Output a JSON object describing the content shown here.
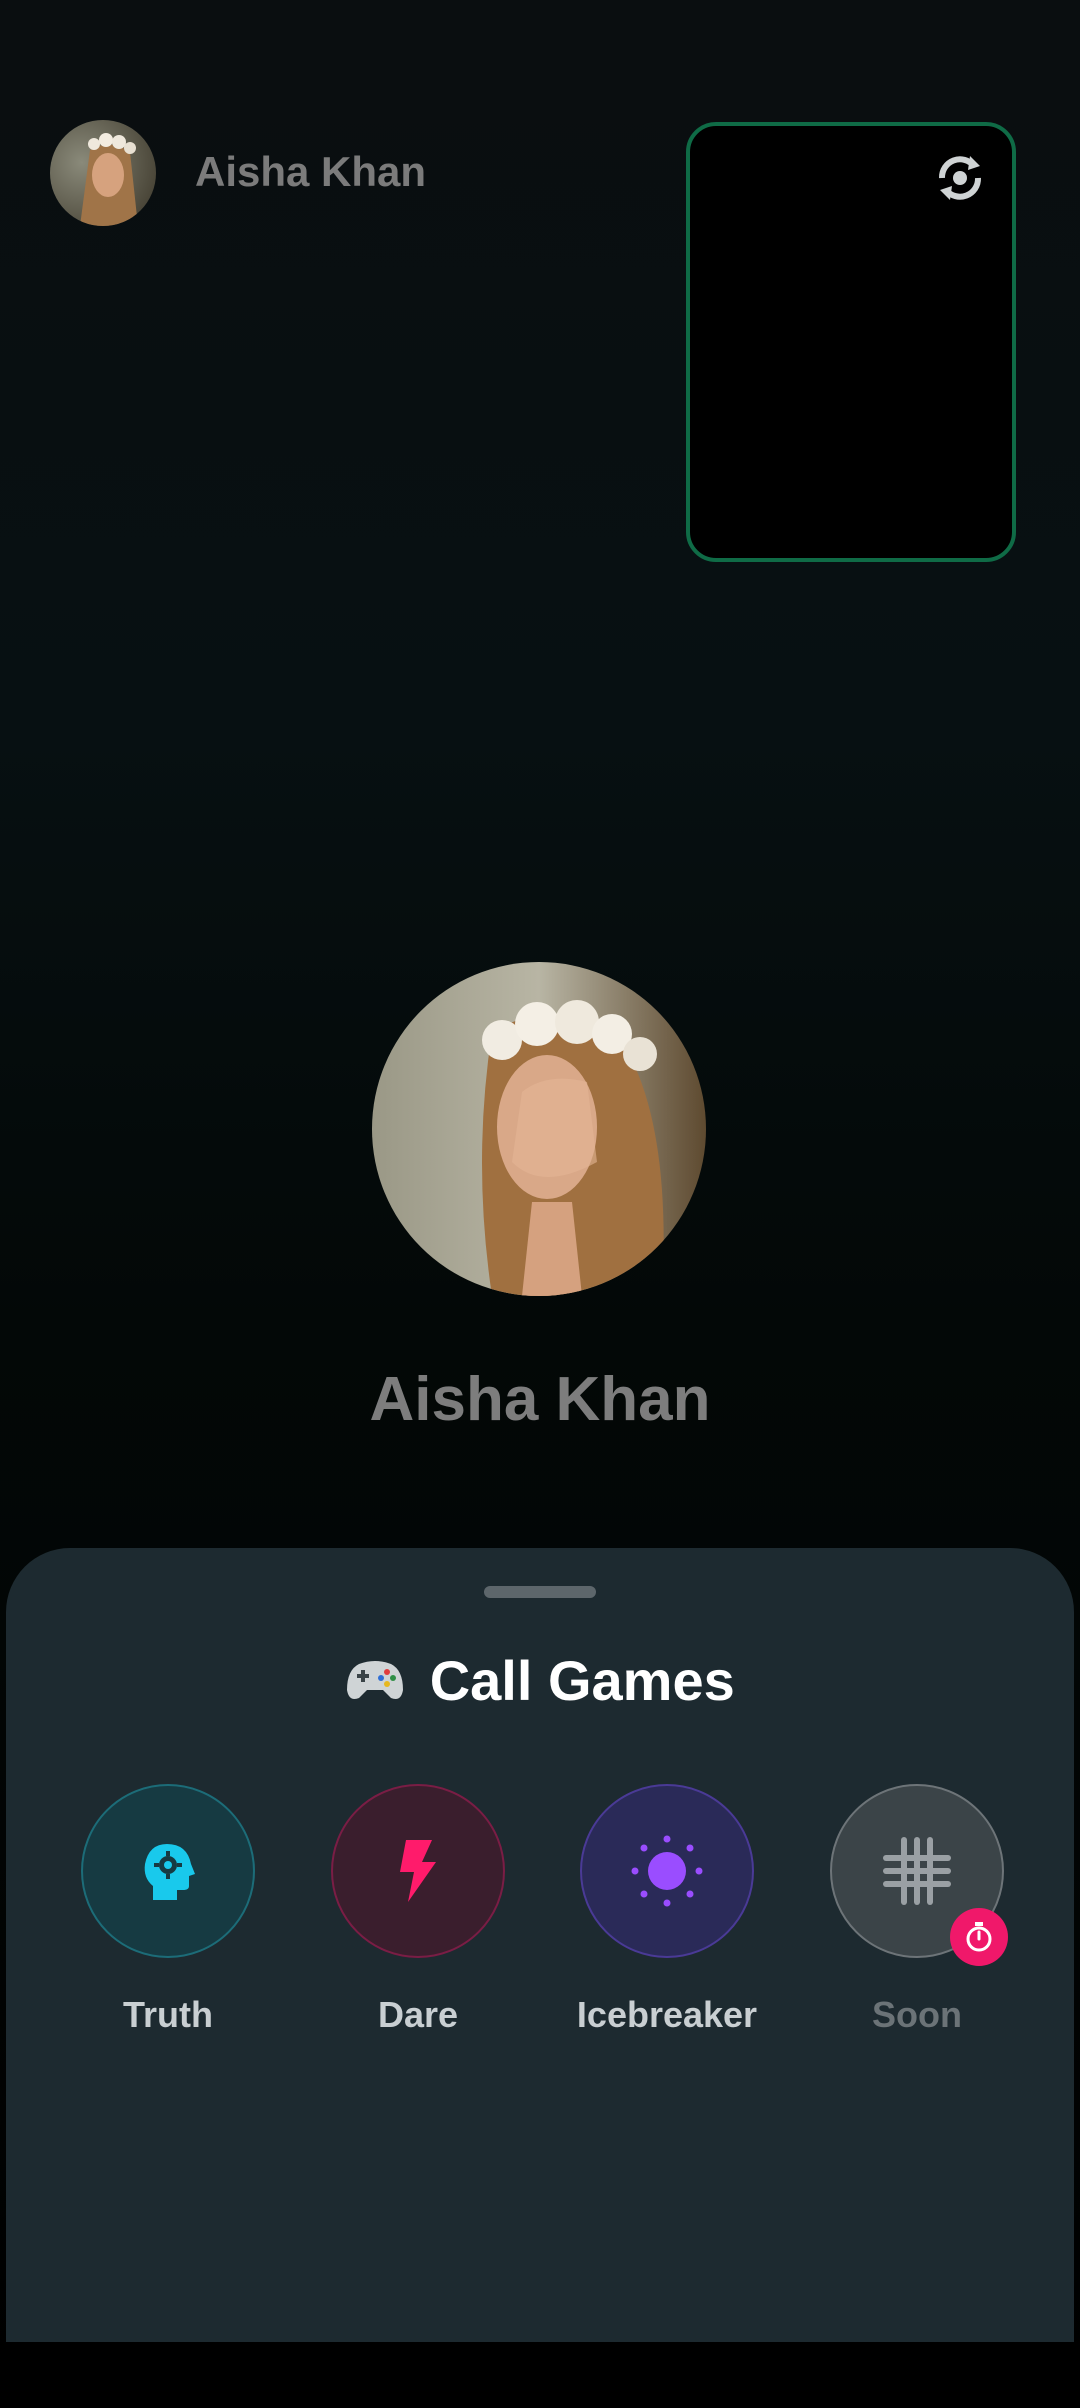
{
  "caller": {
    "name": "Aisha Khan"
  },
  "center": {
    "name": "Aisha Khan"
  },
  "icons": {
    "switch_camera": "switch-camera-icon",
    "game_controller": "game-controller-icon"
  },
  "sheet": {
    "title": "Call Games",
    "games": [
      {
        "label": "Truth",
        "icon": "head-gear-icon",
        "color": "#19c9ec"
      },
      {
        "label": "Dare",
        "icon": "lightning-bolt-icon",
        "color": "#ff1b6b"
      },
      {
        "label": "Icebreaker",
        "icon": "sun-icon",
        "color": "#9a4dff"
      },
      {
        "label": "Soon",
        "icon": "grid-icon",
        "color": "#9aa0a4",
        "badge_icon": "timer-icon",
        "badge_color": "#f0186a"
      }
    ]
  },
  "colors": {
    "self_preview_border": "#0f6b46",
    "sheet_bg": "#1d2a30"
  }
}
